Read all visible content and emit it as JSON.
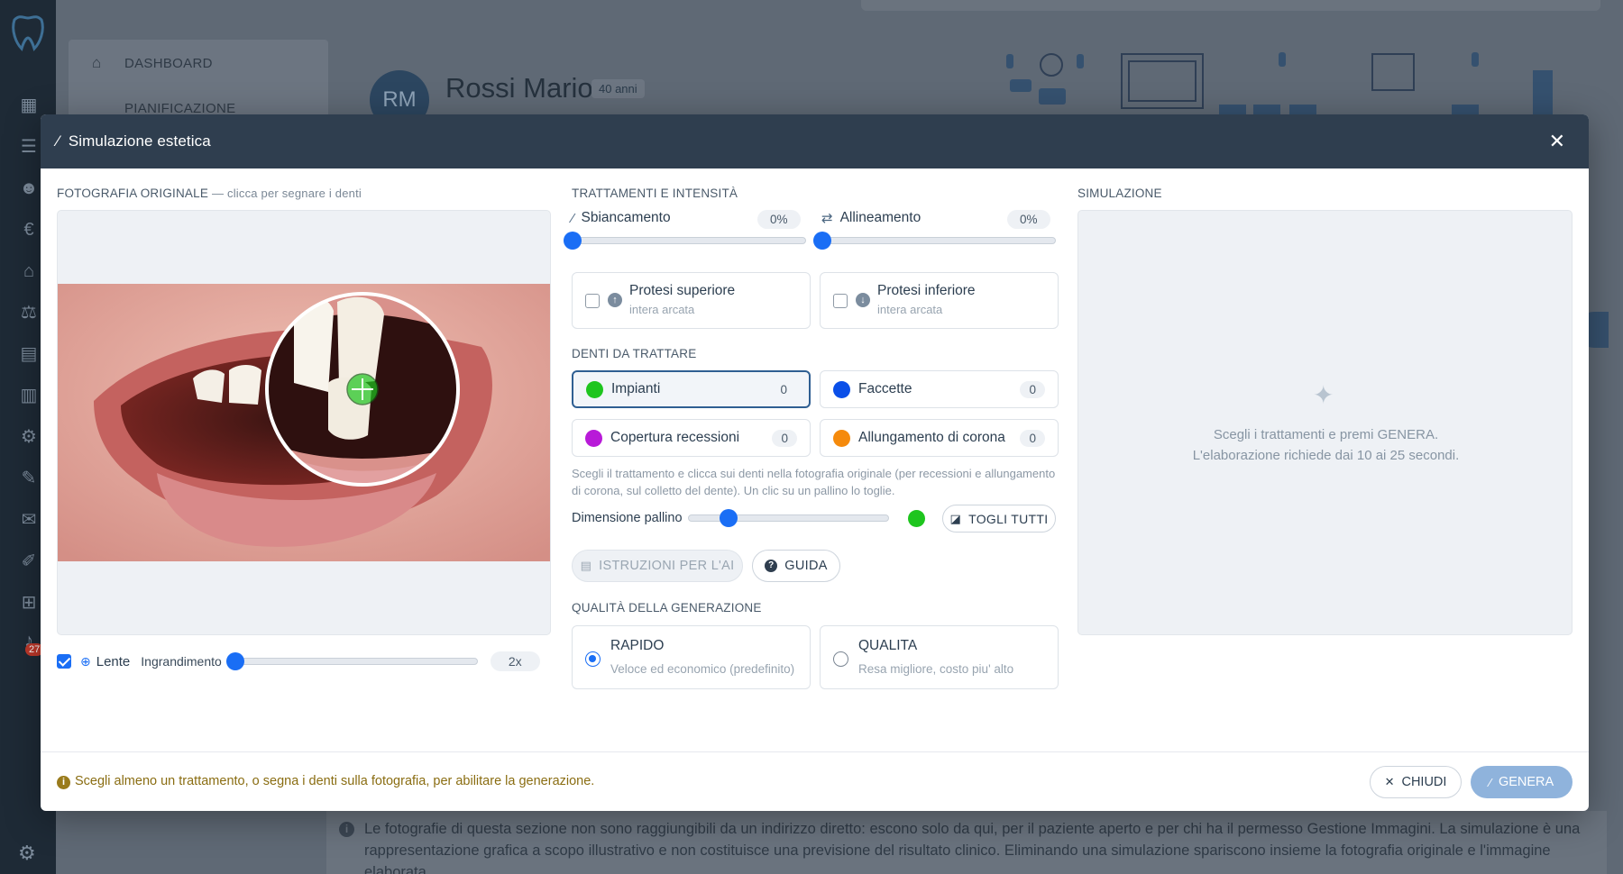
{
  "background": {
    "menu": {
      "items": [
        {
          "label": "DASHBOARD"
        },
        {
          "label": "PIANIFICAZIONE"
        }
      ]
    },
    "patient": {
      "initials": "RM",
      "name": "Rossi Mario",
      "age": "40 anni"
    },
    "notification_count": "27",
    "footer_note": "Le fotografie di questa sezione non sono raggiungibili da un indirizzo diretto: escono solo da qui, per il paziente aperto e per chi ha il permesso Gestione Immagini. La simulazione è una rappresentazione grafica a scopo illustrativo e non costituisce una previsione del risultato clinico. Eliminando una simulazione spariscono insieme la fotografia originale e l'immagine elaborata."
  },
  "modal": {
    "title": "Simulazione estetica",
    "close_icon": "close-icon",
    "original": {
      "label": "FOTOGRAFIA ORIGINALE",
      "hint": "— clicca per segnare i denti",
      "lens": {
        "enabled": true,
        "label": "Lente",
        "zoom_label": "Ingrandimento",
        "zoom_value": "2x",
        "zoom_level": 0.0
      }
    },
    "treatments": {
      "label": "TRATTAMENTI E INTENSITÀ",
      "whitening": {
        "label": "Sbiancamento",
        "value": "0%",
        "level": 0.0,
        "icon": "wand-icon"
      },
      "alignment": {
        "label": "Allineamento",
        "value": "0%",
        "level": 0.0,
        "icon": "swap-icon"
      },
      "upper_prosthesis": {
        "label": "Protesi superiore",
        "sub": "intera arcata",
        "checked": false
      },
      "lower_prosthesis": {
        "label": "Protesi inferiore",
        "sub": "intera arcata",
        "checked": false
      }
    },
    "teeth": {
      "label": "DENTI DA TRATTARE",
      "items": [
        {
          "name": "Impianti",
          "count": "0",
          "color": "#1ec51e",
          "active": true
        },
        {
          "name": "Faccette",
          "count": "0",
          "color": "#0a4fe8",
          "active": false
        },
        {
          "name": "Copertura recessioni",
          "count": "0",
          "color": "#b81ad8",
          "active": false
        },
        {
          "name": "Allungamento di corona",
          "count": "0",
          "color": "#f58a0c",
          "active": false
        }
      ],
      "help": "Scegli il trattamento e clicca sui denti nella fotografia originale (per recessioni e allungamento di corona, sul colletto del dente). Un clic su un pallino lo toglie.",
      "dot_size_label": "Dimensione pallino",
      "dot_size_level": 0.2,
      "dot_color": "#1ec51e",
      "remove_all": "TOGLI TUTTI",
      "ai_instructions": "ISTRUZIONI PER L'AI",
      "guide": "GUIDA"
    },
    "quality": {
      "label": "QUALITÀ DELLA GENERAZIONE",
      "options": [
        {
          "title": "RAPIDO",
          "desc": "Veloce ed economico (predefinito)",
          "selected": true
        },
        {
          "title": "QUALITA",
          "desc": "Resa migliore, costo piu' alto",
          "selected": false
        }
      ]
    },
    "simulation": {
      "label": "SIMULAZIONE",
      "line1": "Scegli i trattamenti e premi GENERA.",
      "line2": "L'elaborazione richiede dai 10 ai 25 secondi."
    },
    "footer": {
      "warning": "Scegli almeno un trattamento, o segna i denti sulla fotografia, per abilitare la generazione.",
      "close_label": "CHIUDI",
      "generate_label": "GENERA"
    }
  }
}
